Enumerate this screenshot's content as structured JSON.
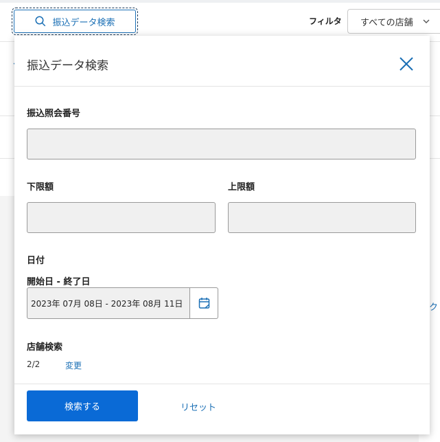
{
  "toolbar": {
    "search_trigger_label": "振込データ検索",
    "filter_label": "フィルタ",
    "store_select_value": "すべての店舗"
  },
  "background": {
    "edge_text": "ーク"
  },
  "modal": {
    "title": "振込データ検索",
    "transfer_ref_label": "振込照会番号",
    "transfer_ref_value": "",
    "min_amount_label": "下限額",
    "min_amount_value": "",
    "max_amount_label": "上限額",
    "max_amount_value": "",
    "date_section_label": "日付",
    "date_range_label": "開始日 - 終了日",
    "date_range_value": "2023年 07月 08日 - 2023年 08月 11日",
    "store_search_label": "店舗検索",
    "store_count": "2/2",
    "change_link": "変更",
    "search_button": "検索する",
    "reset_link": "リセット"
  },
  "colors": {
    "accent": "#1a6fb5",
    "primary_button": "#0a6ad6"
  }
}
